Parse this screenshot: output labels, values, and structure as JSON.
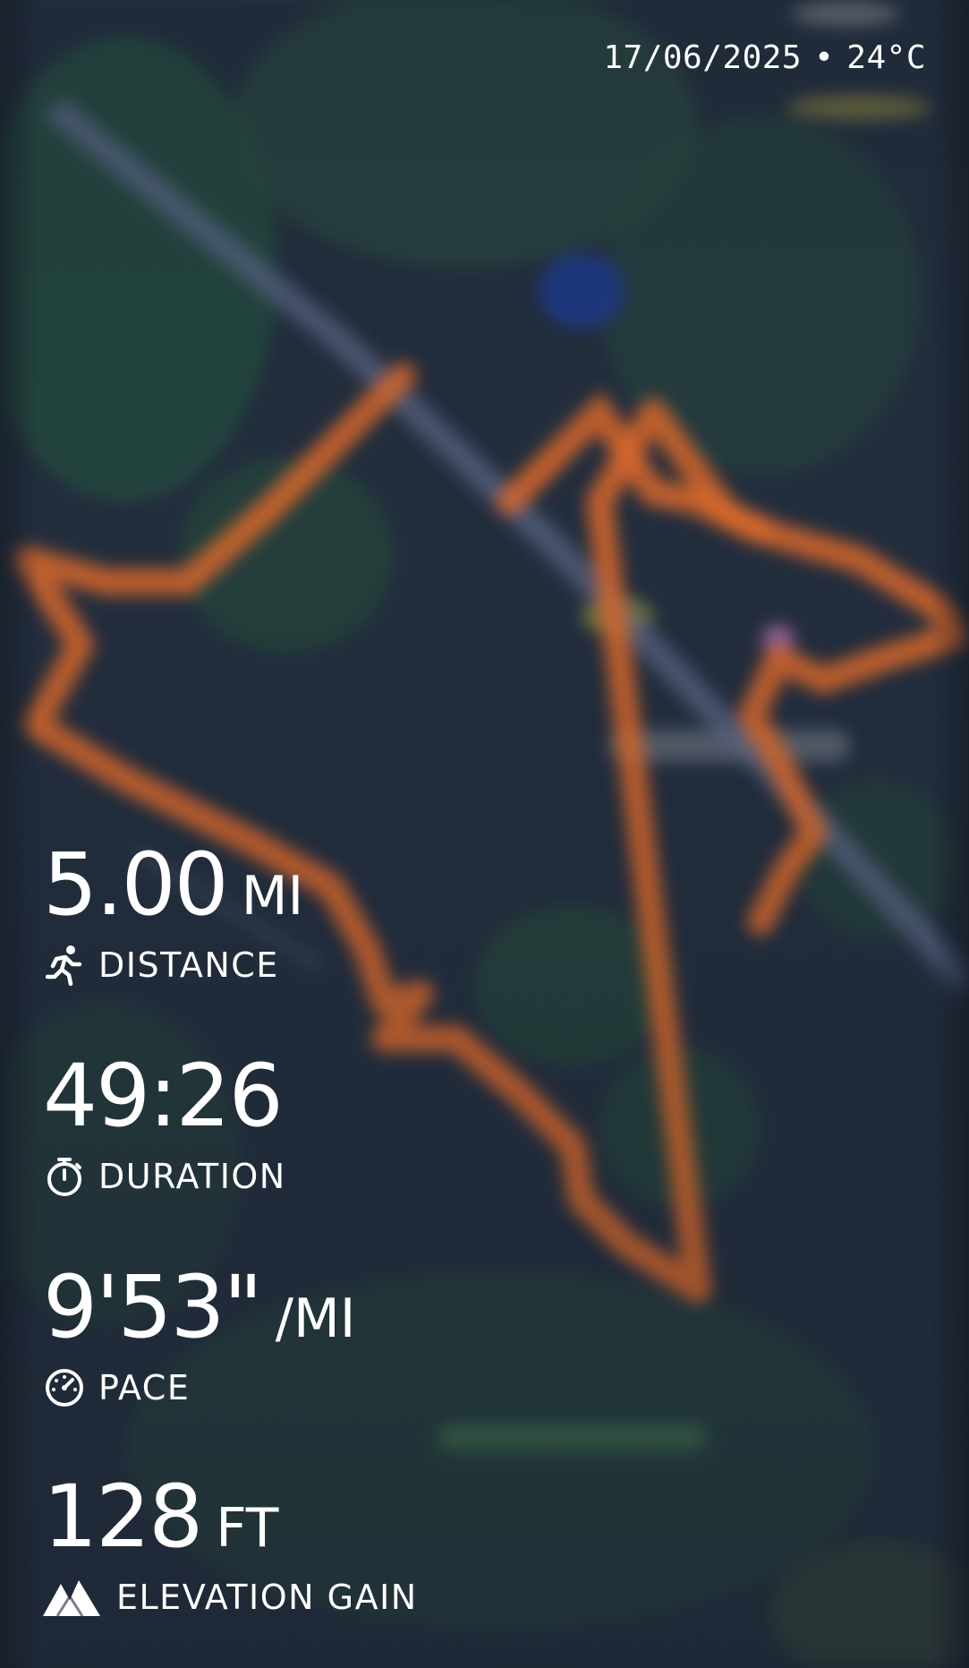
{
  "header": {
    "date": "17/06/2025",
    "separator": "•",
    "temperature": "24°C"
  },
  "stats": {
    "distance": {
      "value": "5.00",
      "unit": "MI",
      "label": "DISTANCE",
      "icon": "runner-icon"
    },
    "duration": {
      "value": "49:26",
      "label": "DURATION",
      "icon": "stopwatch-icon"
    },
    "pace": {
      "value": "9'53\"",
      "unit": "/MI",
      "label": "PACE",
      "icon": "speedometer-icon"
    },
    "elevation": {
      "value": "128",
      "unit": "FT",
      "label": "ELEVATION GAIN",
      "icon": "mountain-icon"
    }
  },
  "colors": {
    "route": "#d9692a",
    "map_background": "#222d3c",
    "text": "#ffffff"
  }
}
